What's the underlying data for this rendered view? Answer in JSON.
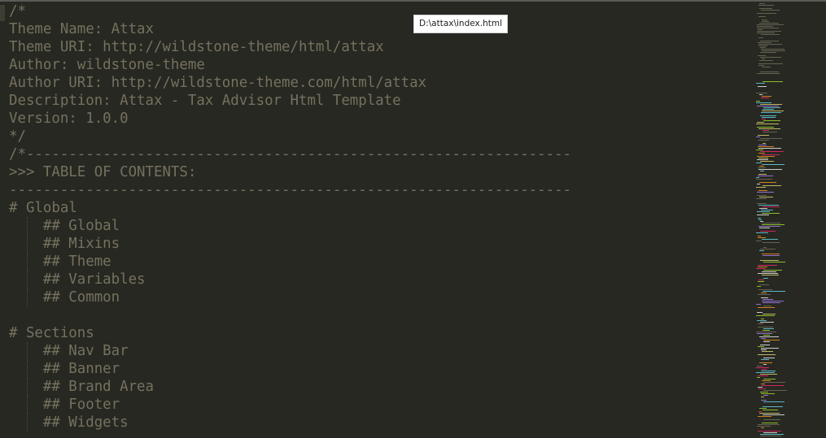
{
  "tooltip": {
    "text": "D:\\attax\\index.html"
  },
  "editor": {
    "lines": [
      {
        "text": "/*",
        "indent": 0
      },
      {
        "text": "Theme Name: Attax",
        "indent": 0
      },
      {
        "text": "Theme URI: http://wildstone-theme/html/attax",
        "indent": 0
      },
      {
        "text": "Author: wildstone-theme",
        "indent": 0
      },
      {
        "text": "Author URI: http://wildstone-theme.com/html/attax",
        "indent": 0
      },
      {
        "text": "Description: Attax - Tax Advisor Html Template",
        "indent": 0
      },
      {
        "text": "Version: 1.0.0",
        "indent": 0
      },
      {
        "text": "*/",
        "indent": 0
      },
      {
        "text": "/*----------------------------------------------------------------",
        "indent": 0
      },
      {
        "text": ">>> TABLE OF CONTENTS:",
        "indent": 0
      },
      {
        "text": "------------------------------------------------------------------",
        "indent": 0
      },
      {
        "text": "# Global",
        "indent": 0
      },
      {
        "text": "## Global",
        "indent": 1
      },
      {
        "text": "## Mixins",
        "indent": 1
      },
      {
        "text": "## Theme",
        "indent": 1
      },
      {
        "text": "## Variables",
        "indent": 1
      },
      {
        "text": "## Common",
        "indent": 1
      },
      {
        "text": "",
        "indent": 0
      },
      {
        "text": "# Sections",
        "indent": 0
      },
      {
        "text": "## Nav Bar",
        "indent": 1
      },
      {
        "text": "## Banner",
        "indent": 1
      },
      {
        "text": "## Brand Area",
        "indent": 1
      },
      {
        "text": "## Footer",
        "indent": 1
      },
      {
        "text": "## Widgets",
        "indent": 1
      },
      {
        "text": "",
        "indent": 0
      }
    ]
  },
  "colors": {
    "background": "#272822",
    "comment": "#75715e",
    "tooltip_bg": "#ffffff",
    "tooltip_text": "#222222"
  }
}
